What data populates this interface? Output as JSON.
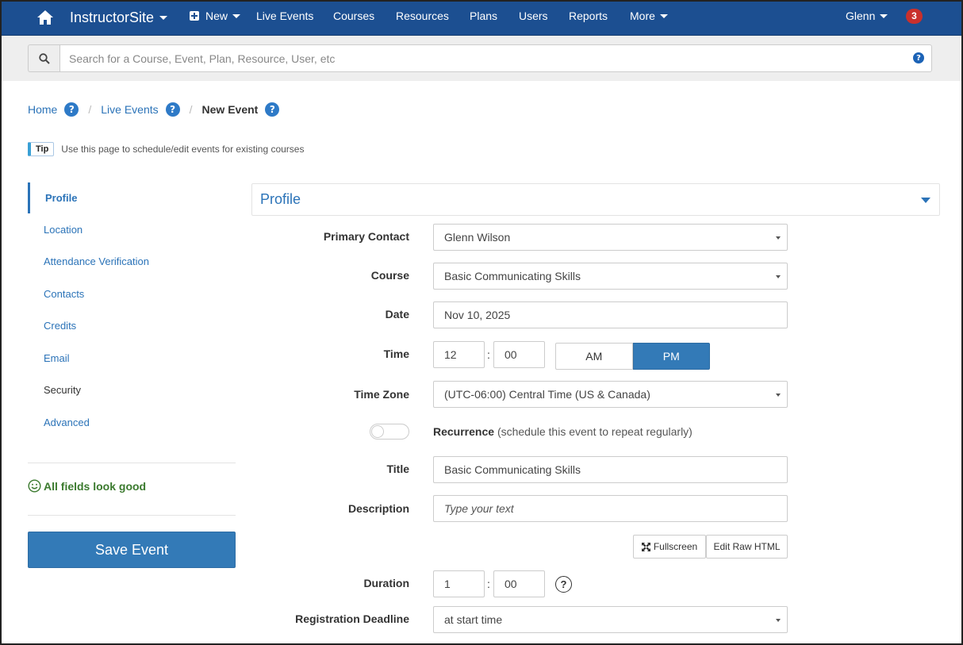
{
  "navbar": {
    "brand": "InstructorSite",
    "new_label": "New",
    "items": [
      "Live Events",
      "Courses",
      "Resources",
      "Plans",
      "Users",
      "Reports"
    ],
    "more_label": "More",
    "user": "Glenn",
    "notifications": "3",
    "bg_color": "#1c4f91"
  },
  "search": {
    "placeholder": "Search for a Course, Event, Plan, Resource, User, etc"
  },
  "breadcrumb": {
    "home": "Home",
    "live_events": "Live Events",
    "current": "New Event"
  },
  "tip": {
    "label": "Tip",
    "text": "Use this page to schedule/edit events for existing courses"
  },
  "sidenav": {
    "items": [
      "Profile",
      "Location",
      "Attendance Verification",
      "Contacts",
      "Credits",
      "Email",
      "Security",
      "Advanced"
    ],
    "status": "All fields look good",
    "save_label": "Save Event"
  },
  "panel": {
    "title": "Profile"
  },
  "form": {
    "primary_contact": {
      "label": "Primary Contact",
      "value": "Glenn Wilson"
    },
    "course": {
      "label": "Course",
      "value": "Basic Communicating Skills"
    },
    "date": {
      "label": "Date",
      "value": "Nov 10, 2025"
    },
    "time": {
      "label": "Time",
      "hour": "12",
      "minute": "00",
      "am": "AM",
      "pm": "PM",
      "selected": "PM"
    },
    "time_zone": {
      "label": "Time Zone",
      "value": "(UTC-06:00) Central Time (US & Canada)"
    },
    "recurrence": {
      "label": "Recurrence",
      "hint": "(schedule this event to repeat regularly)",
      "enabled": false
    },
    "title": {
      "label": "Title",
      "value": "Basic Communicating Skills"
    },
    "description": {
      "label": "Description",
      "placeholder": "Type your text",
      "fullscreen": "Fullscreen",
      "edit_raw": "Edit Raw HTML"
    },
    "duration": {
      "label": "Duration",
      "hours": "1",
      "minutes": "00"
    },
    "registration_deadline": {
      "label": "Registration Deadline",
      "value": "at start time"
    }
  },
  "icons": {
    "home": "home-icon",
    "search": "search-icon",
    "help": "question-circle-icon",
    "smile": "smile-icon",
    "expand": "expand-icon"
  }
}
